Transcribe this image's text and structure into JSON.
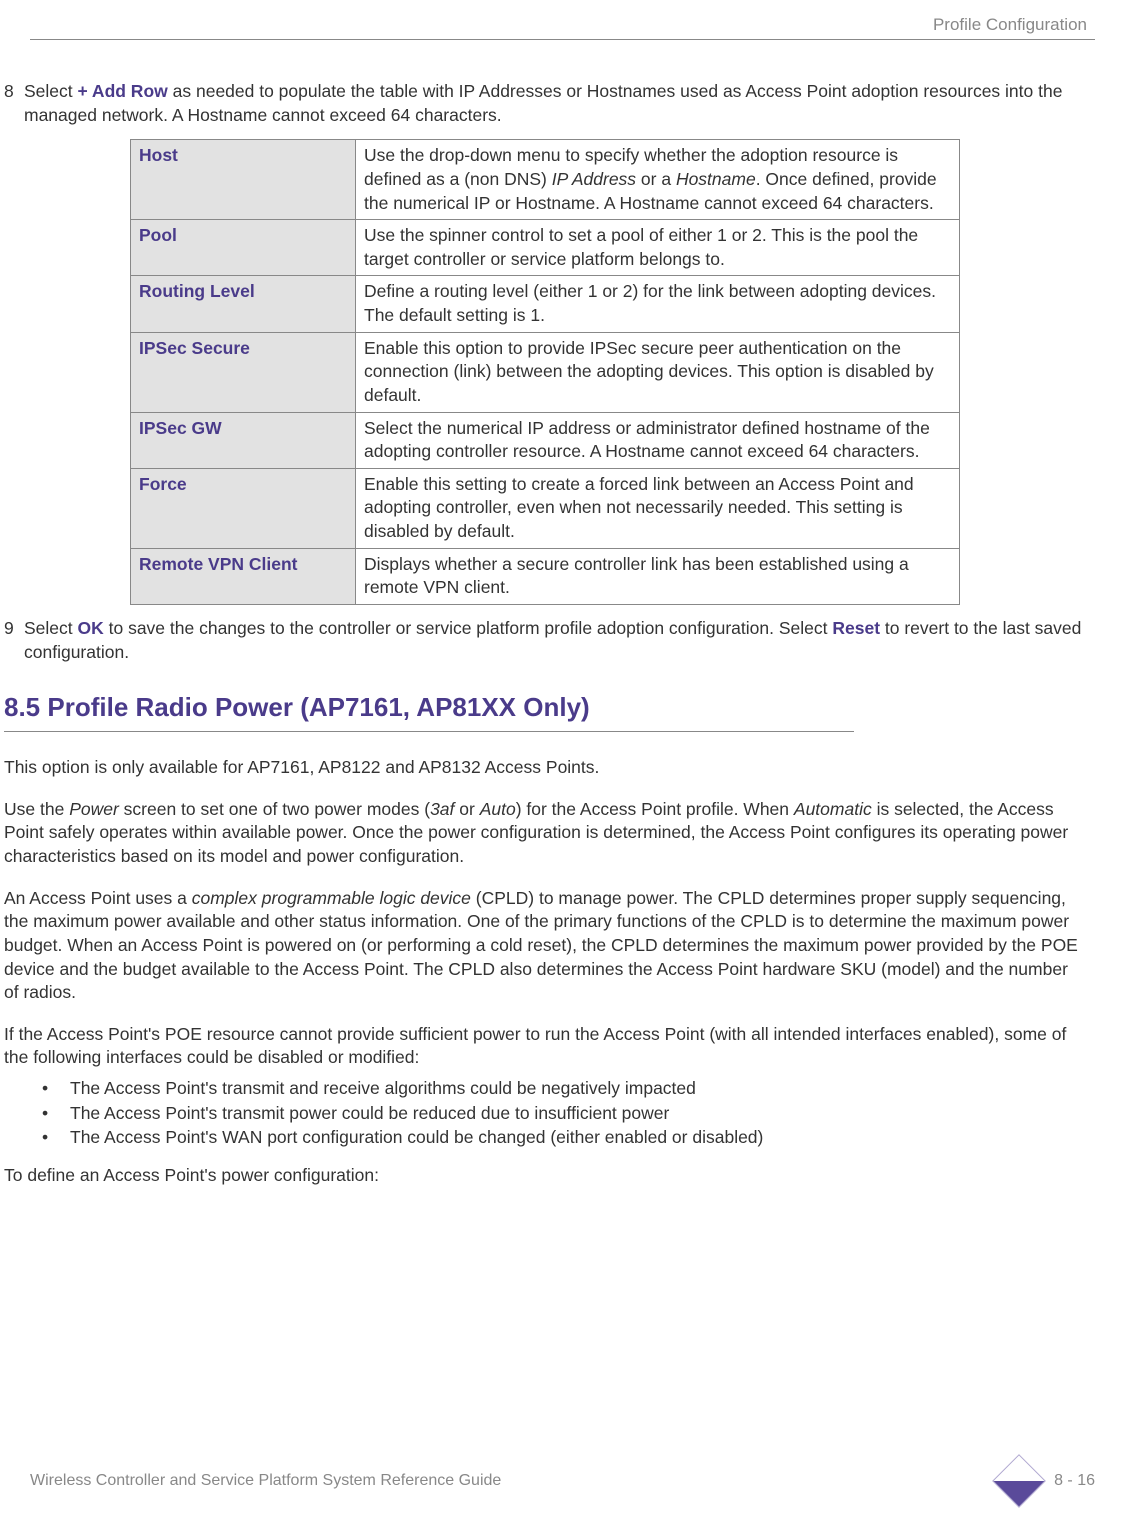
{
  "header": {
    "title": "Profile Configuration"
  },
  "step8": {
    "num": "8",
    "pre": "Select ",
    "bold1": "+ Add Row",
    "post": " as needed to populate the table with IP Addresses or Hostnames used as Access Point adoption resources into the managed network. A Hostname cannot exceed 64 characters."
  },
  "table": [
    {
      "label": "Host",
      "desc_pre": "Use the drop-down menu to specify whether the adoption resource is defined as a (non DNS) ",
      "it1": "IP Address",
      "desc_mid": " or a ",
      "it2": "Hostname",
      "desc_post": ". Once defined, provide the numerical IP or Hostname. A Hostname cannot exceed 64 characters."
    },
    {
      "label": "Pool",
      "desc": "Use the spinner control to set a pool of either 1 or 2. This is the pool the target controller or service platform belongs to."
    },
    {
      "label": "Routing Level",
      "desc": "Define a routing level (either 1 or 2) for the link between adopting devices. The default setting is 1."
    },
    {
      "label": "IPSec Secure",
      "desc": "Enable this option to provide IPSec secure peer authentication on the connection (link) between the adopting devices. This option is disabled by default."
    },
    {
      "label": "IPSec GW",
      "desc": "Select the numerical IP address or administrator defined hostname of the adopting controller resource. A Hostname cannot exceed 64 characters."
    },
    {
      "label": "Force",
      "desc": "Enable this setting to create a forced link between an Access Point and adopting controller, even when not necessarily needed. This setting is disabled by default."
    },
    {
      "label": "Remote VPN Client",
      "desc": "Displays whether a secure controller link has been established using a remote VPN client."
    }
  ],
  "step9": {
    "num": "9",
    "pre": "Select ",
    "bold1": "OK",
    "mid": " to save the changes to the controller or service platform profile adoption configuration. Select ",
    "bold2": "Reset",
    "post": " to revert to the last saved configuration."
  },
  "section85": {
    "title": "8.5 Profile Radio Power (AP7161, AP81XX Only)",
    "p1": "This option is only available for AP7161, AP8122 and AP8132 Access Points.",
    "p2_pre": "Use the ",
    "p2_it1": "Power",
    "p2_mid1": " screen to set one of two power modes (",
    "p2_it2": "3af",
    "p2_mid2": " or ",
    "p2_it3": "Auto",
    "p2_mid3": ") for the Access Point profile. When ",
    "p2_it4": "Automatic",
    "p2_post": " is selected, the Access Point safely operates within available power. Once the power configuration is determined, the Access Point configures its operating power characteristics based on its model and power configuration.",
    "p3_pre": "An Access Point uses a ",
    "p3_it": "complex programmable logic device",
    "p3_post": " (CPLD) to manage power. The CPLD determines proper supply sequencing, the maximum power available and other status information. One of the primary functions of the CPLD is to determine the maximum power budget. When an Access Point is powered on (or performing a cold reset), the CPLD determines the maximum power provided by the POE device and the budget available to the Access Point. The CPLD also determines the Access Point hardware SKU (model) and the number of radios.",
    "p4": "If the Access Point's POE resource cannot provide sufficient power to run the Access Point (with all intended interfaces enabled), some of the following interfaces could be disabled or modified:",
    "bullets": [
      "The Access Point's transmit and receive algorithms could be negatively impacted",
      "The Access Point's transmit power could be reduced due to insufficient power",
      "The Access Point's WAN port configuration could be changed (either enabled or disabled)"
    ],
    "p5": "To define an Access Point's power configuration:"
  },
  "footer": {
    "left": "Wireless Controller and Service Platform System Reference Guide",
    "right": "8 - 16"
  }
}
